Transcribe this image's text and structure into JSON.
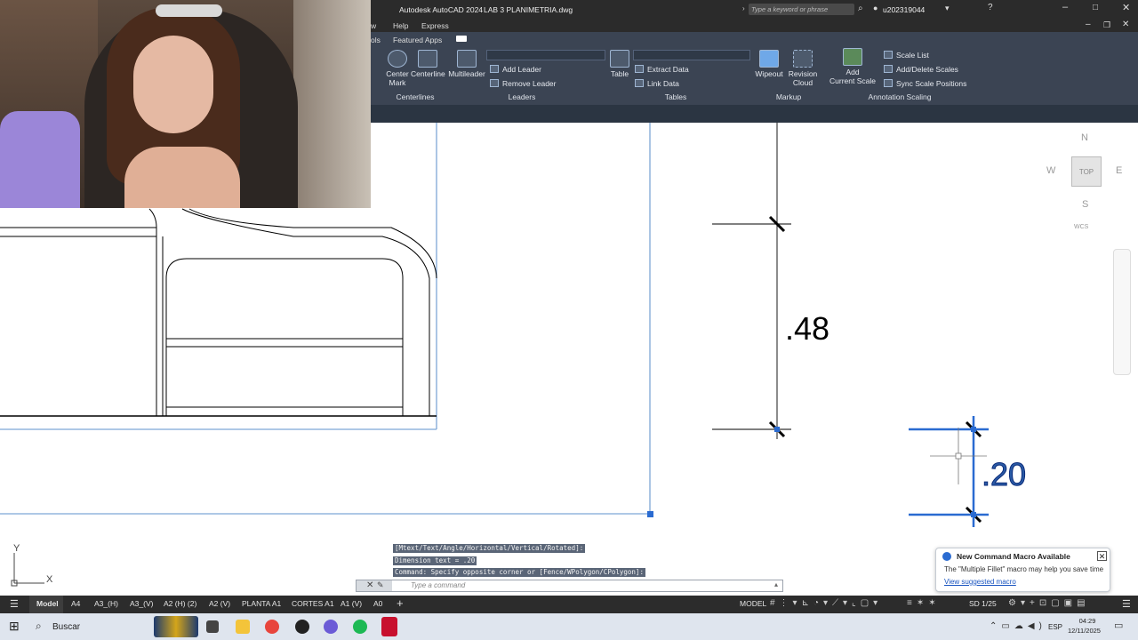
{
  "titlebar": {
    "app_title": "Autodesk AutoCAD 2024",
    "file_name": "LAB 3 PLANIMETRIA.dwg",
    "search_placeholder": "Type a keyword or phrase",
    "user": "u202319044"
  },
  "menu": {
    "items": [
      "w",
      "Help",
      "Express"
    ]
  },
  "ribbon_tabs": [
    "ols",
    "Featured Apps"
  ],
  "ribbon": {
    "centerlines": {
      "center_mark": "Center\nMark",
      "centerline": "Centerline",
      "label": "Centerlines"
    },
    "leaders": {
      "multileader": "Multileader",
      "add_leader": "Add Leader",
      "remove_leader": "Remove Leader",
      "label": "Leaders"
    },
    "tables": {
      "table": "Table",
      "extract_data": "Extract Data",
      "link_data": "Link Data",
      "label": "Tables"
    },
    "markup": {
      "wipeout": "Wipeout",
      "revision_cloud": "Revision\nCloud",
      "label": "Markup"
    },
    "annotation_scaling": {
      "add_current_scale": "Add\nCurrent Scale",
      "scale_list": "Scale List",
      "add_delete_scales": "Add/Delete Scales",
      "sync_scale_positions": "Sync Scale Positions",
      "label": "Annotation Scaling"
    }
  },
  "viewcube": {
    "n": "N",
    "s": "S",
    "e": "E",
    "w": "W",
    "face": "TOP",
    "wcs": "WCS"
  },
  "drawing": {
    "dim1": ".48",
    "dim2": ".20"
  },
  "ucs": {
    "x": "X",
    "y": "Y"
  },
  "command": {
    "history": [
      "[Mtext/Text/Angle/Horizontal/Vertical/Rotated]:",
      "Dimension text = .20",
      "Command: Specify opposite corner or [Fence/WPolygon/CPolygon]:"
    ],
    "placeholder": "Type a command"
  },
  "layout_tabs": [
    "Model",
    "A4",
    "A3_(H)",
    "A3_(V)",
    "A2 (H) (2)",
    "A2 (V)",
    "PLANTA A1",
    "CORTES A1",
    "A1 (V)",
    "A0"
  ],
  "status": {
    "model": "MODEL",
    "scale": "SD 1/25"
  },
  "notification": {
    "title": "New Command Macro Available",
    "body": "The \"Multiple Fillet\" macro may help you save time",
    "link": "View suggested macro"
  },
  "taskbar": {
    "search": "Buscar",
    "lang": "ESP",
    "time": "04:29",
    "date": "12/11/2025"
  },
  "colors": {
    "accent": "#2a6bd1",
    "ribbon": "#3b4453",
    "titlebar": "#2b2b2b"
  }
}
